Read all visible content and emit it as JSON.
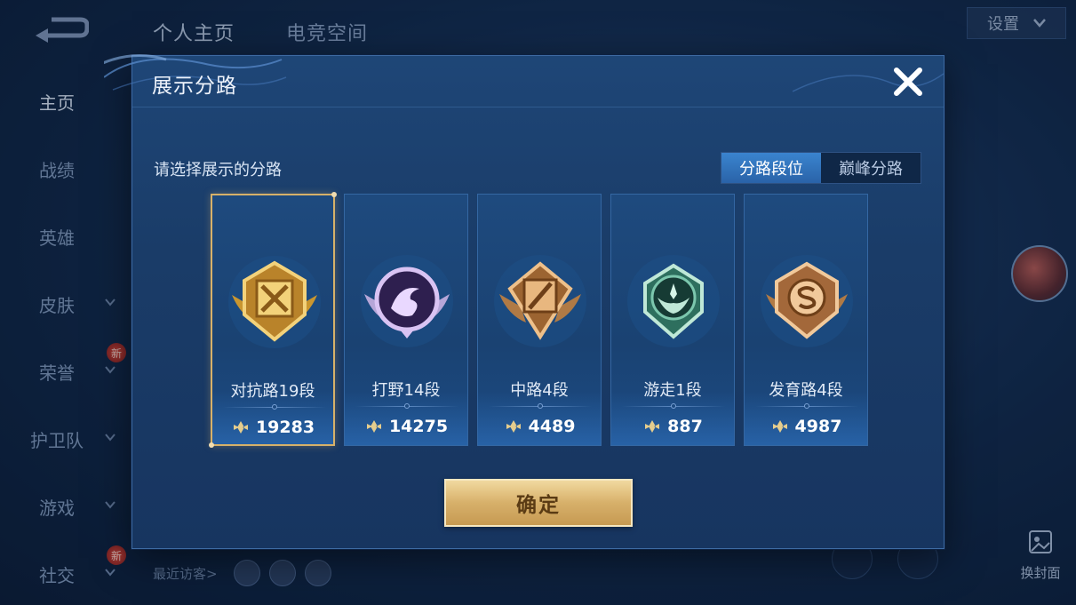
{
  "top_tabs": [
    {
      "label": "个人主页"
    },
    {
      "label": "电竞空间"
    }
  ],
  "settings_label": "设置",
  "sidebar": {
    "items": [
      {
        "label": "主页",
        "active": true,
        "chevron": false,
        "badge": ""
      },
      {
        "label": "战绩",
        "active": false,
        "chevron": false,
        "badge": ""
      },
      {
        "label": "英雄",
        "active": false,
        "chevron": false,
        "badge": ""
      },
      {
        "label": "皮肤",
        "active": false,
        "chevron": true,
        "badge": ""
      },
      {
        "label": "荣誉",
        "active": false,
        "chevron": true,
        "badge": "新"
      },
      {
        "label": "护卫队",
        "active": false,
        "chevron": true,
        "badge": ""
      },
      {
        "label": "游戏",
        "active": false,
        "chevron": true,
        "badge": ""
      },
      {
        "label": "社交",
        "active": false,
        "chevron": true,
        "badge": "新"
      }
    ]
  },
  "visitors_label": "最近访客>",
  "change_cover_label": "换封面",
  "modal": {
    "title": "展示分路",
    "subtitle": "请选择展示的分路",
    "toggle": [
      {
        "label": "分路段位",
        "active": true
      },
      {
        "label": "巅峰分路",
        "active": false
      }
    ],
    "lanes": [
      {
        "name": "对抗路19段",
        "score": "19283",
        "selected": true,
        "medal": "gold-crossed-swords-medal-icon",
        "colors": [
          "#f3d27a",
          "#b9832a"
        ]
      },
      {
        "name": "打野14段",
        "score": "14275",
        "selected": false,
        "medal": "purple-dragon-medal-icon",
        "colors": [
          "#d9c3f3",
          "#7a4fb5"
        ]
      },
      {
        "name": "中路4段",
        "score": "4489",
        "selected": false,
        "medal": "bronze-staff-medal-icon",
        "colors": [
          "#eec08a",
          "#9c6431"
        ]
      },
      {
        "name": "游走1段",
        "score": "887",
        "selected": false,
        "medal": "green-wings-medal-icon",
        "colors": [
          "#bfe8d7",
          "#3f8f78"
        ]
      },
      {
        "name": "发育路4段",
        "score": "4987",
        "selected": false,
        "medal": "bronze-s-medal-icon",
        "colors": [
          "#f1c99b",
          "#a3683a"
        ]
      }
    ],
    "confirm_label": "确定"
  },
  "colors": {
    "accent_blue": "#2a63a8",
    "gold": "#d7b169",
    "panel": "#1a3c68"
  }
}
